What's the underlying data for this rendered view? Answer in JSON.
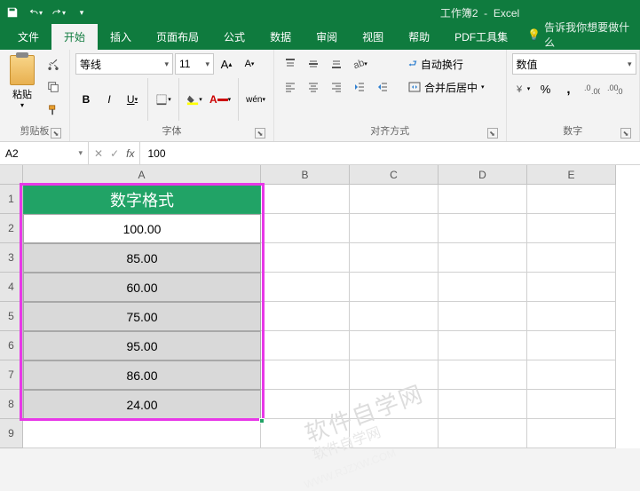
{
  "title": {
    "doc": "工作簿2",
    "app": "Excel"
  },
  "tabs": {
    "file": "文件",
    "home": "开始",
    "insert": "插入",
    "layout": "页面布局",
    "formulas": "公式",
    "data": "数据",
    "review": "审阅",
    "view": "视图",
    "help": "帮助",
    "pdf": "PDF工具集",
    "tellme": "告诉我你想要做什么"
  },
  "ribbon": {
    "clipboard": {
      "paste": "粘贴",
      "label": "剪贴板"
    },
    "font": {
      "name": "等线",
      "size": "11",
      "label": "字体",
      "bold": "B",
      "italic": "I",
      "underline": "U",
      "pinyin": "wén"
    },
    "align": {
      "wrap": "自动换行",
      "merge": "合并后居中",
      "label": "对齐方式"
    },
    "number": {
      "format": "数值",
      "label": "数字"
    }
  },
  "fbar": {
    "ref": "A2",
    "value": "100"
  },
  "colhdrs": [
    "A",
    "B",
    "C",
    "D",
    "E"
  ],
  "rowhdrs": [
    "1",
    "2",
    "3",
    "4",
    "5",
    "6",
    "7",
    "8",
    "9"
  ],
  "sheet": {
    "header": "数字格式",
    "values": [
      "100.00",
      "85.00",
      "60.00",
      "75.00",
      "95.00",
      "86.00",
      "24.00"
    ]
  },
  "watermark": {
    "main": "软件自学网",
    "sub": "软件自学网",
    "url": "WWW.RJZXW.COM"
  }
}
